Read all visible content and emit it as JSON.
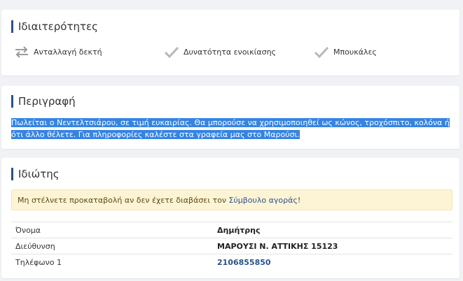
{
  "features": {
    "title": "Ιδιαιτερότητες",
    "items": [
      {
        "label": "Ανταλλαγή δεκτή",
        "icon": "swap-arrows-icon"
      },
      {
        "label": "Δυνατότητα ενοικίασης",
        "icon": "check-icon"
      },
      {
        "label": "Μπουκάλες",
        "icon": "check-icon"
      }
    ]
  },
  "description": {
    "title": "Περιγραφή",
    "text": "Πωλείται ο Νεντελτσιάρου, σε τιμή ευκαιρίας. Θα μπορούσε να χρησιμοποιηθεί ως κώνος, τροχόσπιτο, κολόνα ή ότι άλλο θέλετε. Για πληροφορίες καλέστε στα γραφεία μας στο Μαρούσι."
  },
  "owner": {
    "title": "Ιδιώτης",
    "alert_text": "Μη στέλνετε προκαταβολή αν δεν έχετε διαβάσει τον ",
    "alert_link": "Σύμβουλο αγοράς",
    "alert_suffix": "!",
    "rows": [
      {
        "label": "Όνομα",
        "value": "Δημήτρης"
      },
      {
        "label": "Διεύθυνση",
        "value": "ΜΑΡΟΥΣΙ Ν. ΑΤΤΙΚΗΣ 15123"
      },
      {
        "label": "Τηλέφωνο 1",
        "value": "2106855850"
      }
    ]
  },
  "colors": {
    "accent": "#2a5289",
    "selection": "#3584e4",
    "alert_bg": "#fdf4d5"
  }
}
